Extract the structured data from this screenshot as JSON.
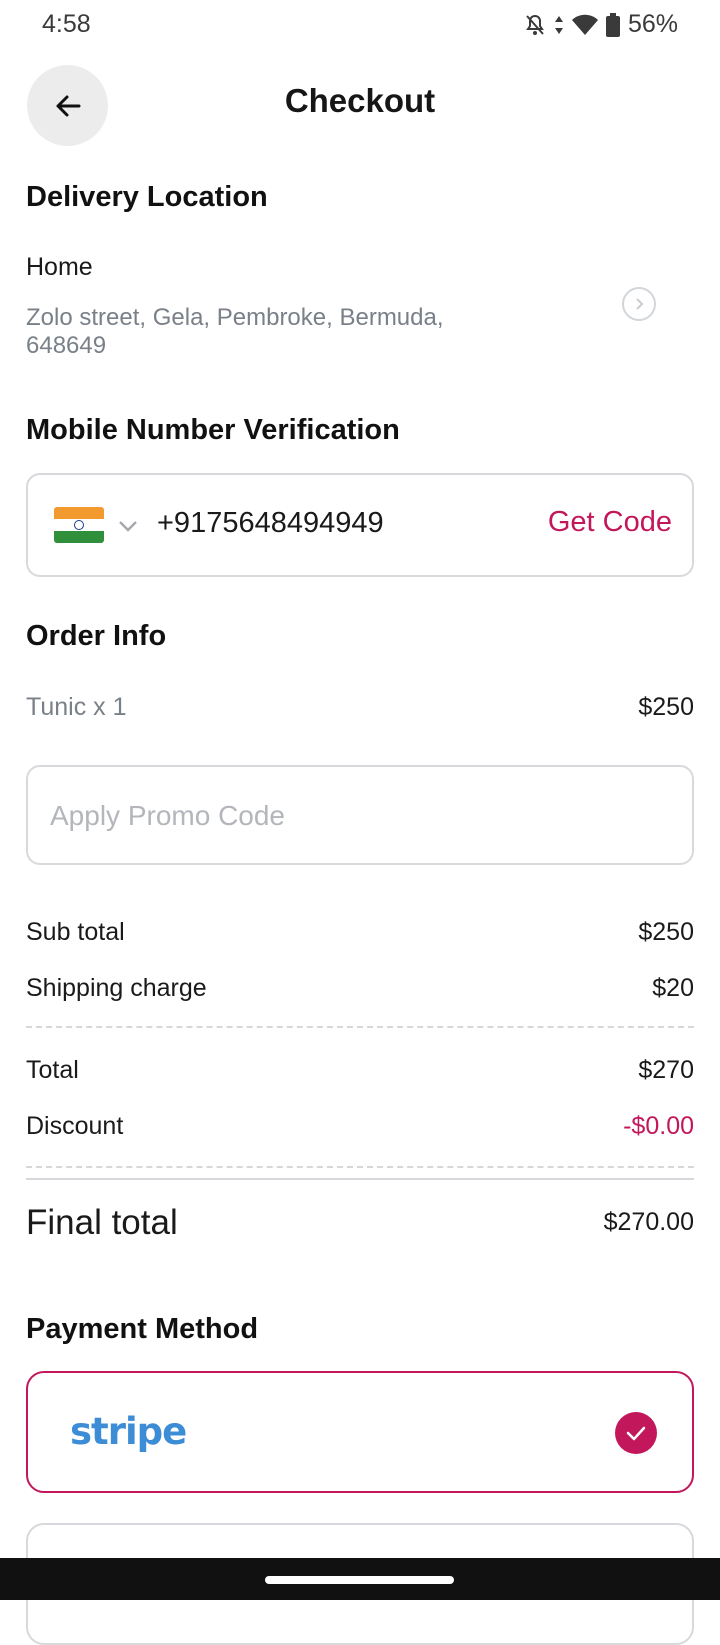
{
  "status_bar": {
    "time": "4:58",
    "battery": "56%"
  },
  "header": {
    "title": "Checkout"
  },
  "delivery": {
    "section_title": "Delivery Location",
    "address_label": "Home",
    "address_line1": "Zolo street, Gela, Pembroke, Bermuda,",
    "address_line2": "648649"
  },
  "mobile": {
    "section_title": "Mobile Number Verification",
    "phone_number": "+9175648494949",
    "get_code_label": "Get Code"
  },
  "order": {
    "section_title": "Order Info",
    "item_label": "Tunic x 1",
    "item_price": "$250",
    "promo_placeholder": "Apply Promo Code",
    "subtotal_label": "Sub total",
    "subtotal_value": "$250",
    "shipping_label": "Shipping charge",
    "shipping_value": "$20",
    "total_label": "Total",
    "total_value": "$270",
    "discount_label": "Discount",
    "discount_value": "-$0.00",
    "final_label": "Final total",
    "final_value": "$270.00"
  },
  "payment": {
    "section_title": "Payment Method",
    "option1": "stripe"
  },
  "colors": {
    "accent": "#c2185b",
    "stripe": "#3d8cd6"
  }
}
